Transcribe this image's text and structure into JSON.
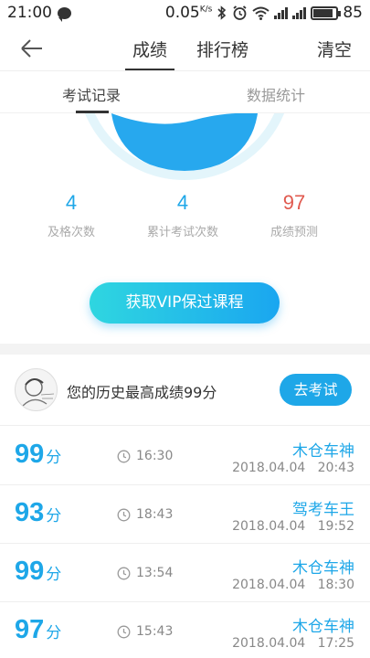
{
  "status_bar": {
    "time": "21:00",
    "speed": "0.05",
    "speed_unit": "K/s",
    "battery": "85"
  },
  "nav": {
    "tab_score": "成绩",
    "tab_rank": "排行榜",
    "clear": "清空"
  },
  "sub_tabs": {
    "records": "考试记录",
    "stats": "数据统计"
  },
  "stats": [
    {
      "value": "4",
      "label": "及格次数",
      "color": "#1ea7e8"
    },
    {
      "value": "4",
      "label": "累计考试次数",
      "color": "#1ea7e8"
    },
    {
      "value": "97",
      "label": "成绩预测",
      "color": "#e05a4f"
    }
  ],
  "vip_button": "获取VIP保过课程",
  "best": {
    "text": "您的历史最高成绩99分",
    "button": "去考试"
  },
  "records": [
    {
      "score": "99",
      "unit": "分",
      "duration": "16:30",
      "user": "木仓车神",
      "date": "2018.04.04",
      "time": "20:43"
    },
    {
      "score": "93",
      "unit": "分",
      "duration": "18:43",
      "user": "驾考车王",
      "date": "2018.04.04",
      "time": "19:52"
    },
    {
      "score": "99",
      "unit": "分",
      "duration": "13:54",
      "user": "木仓车神",
      "date": "2018.04.04",
      "time": "18:30"
    },
    {
      "score": "97",
      "unit": "分",
      "duration": "15:43",
      "user": "木仓车神",
      "date": "2018.04.04",
      "time": "17:25"
    }
  ]
}
